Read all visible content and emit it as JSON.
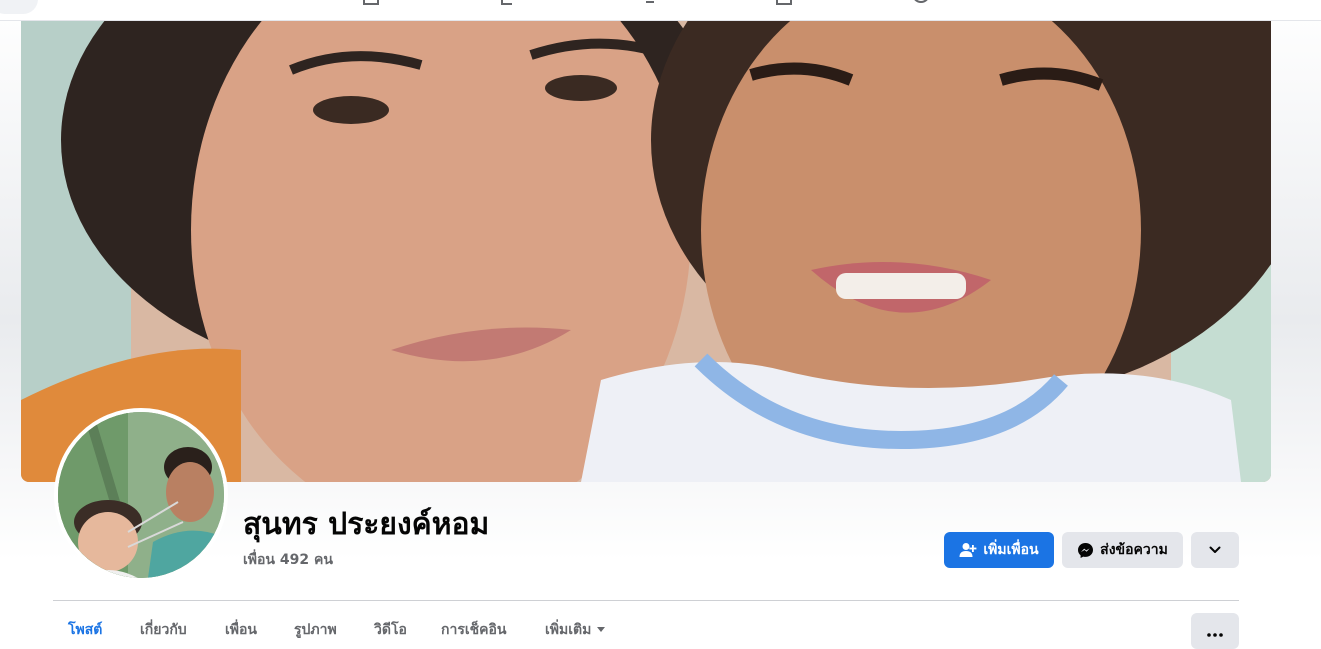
{
  "profile": {
    "name": "สุนทร ประยงค์หอม",
    "friends_count": "เพื่อน 492 คน"
  },
  "actions": {
    "add_friend": "เพิ่มเพื่อน",
    "message": "ส่งข้อความ"
  },
  "tabs": [
    {
      "label": "โพสต์",
      "active": true
    },
    {
      "label": "เกี่ยวกับ",
      "active": false
    },
    {
      "label": "เพื่อน",
      "active": false
    },
    {
      "label": "รูปภาพ",
      "active": false
    },
    {
      "label": "วิดีโอ",
      "active": false
    },
    {
      "label": "การเช็คอิน",
      "active": false
    },
    {
      "label": "เพิ่มเติม",
      "active": false
    }
  ],
  "icons": {
    "add_friend": "person-plus-icon",
    "message": "messenger-icon",
    "dropdown": "chevron-down-icon",
    "more": "ellipsis-icon",
    "tab_more": "caret-down-icon",
    "nav": [
      "home-icon",
      "watch-icon",
      "groups-icon",
      "marketplace-icon",
      "gaming-icon"
    ]
  },
  "colors": {
    "accent": "#1b74e4",
    "button_gray": "#e4e6eb",
    "text_primary": "#050505",
    "text_secondary": "#65676b"
  }
}
